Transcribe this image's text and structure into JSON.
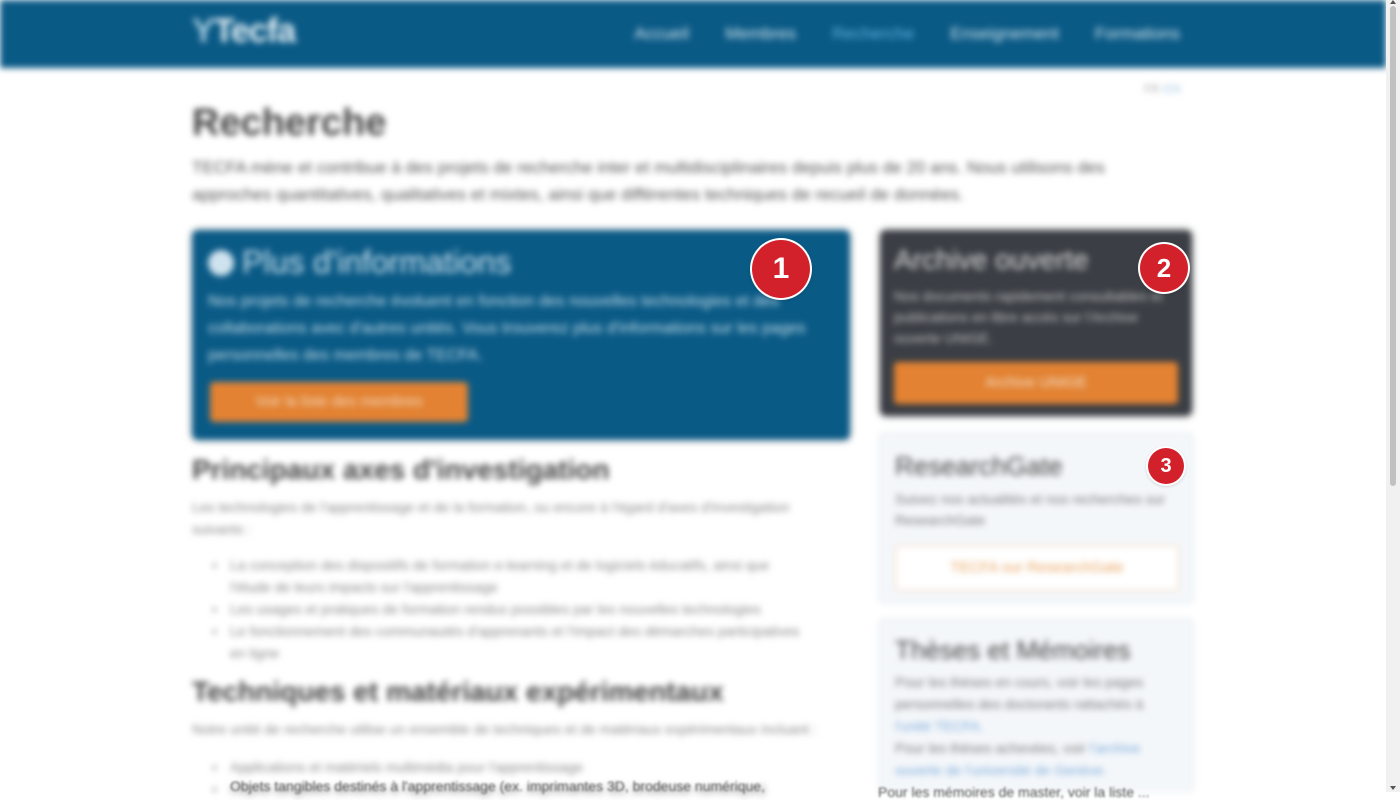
{
  "header": {
    "logo_prefix": "Y",
    "logo_text": "Tecfa",
    "nav": [
      "Accueil",
      "Membres",
      "Recherche",
      "Enseignement",
      "Formations"
    ],
    "active_index": 2
  },
  "lang": {
    "current": "FR",
    "alt": "EN"
  },
  "page": {
    "title": "Recherche",
    "intro": "TECFA mène et contribue à des projets de recherche inter et multidisciplinaires depuis plus de 20 ans. Nous utilisons des approches quantitatives, qualitatives et mixtes, ainsi que différentes techniques de recueil de données."
  },
  "info_box": {
    "title": "Plus d'informations",
    "text": "Nos projets de recherche évoluent en fonction des nouvelles technologies et des collaborations avec d'autres unités. Vous trouverez plus d'informations sur les pages personnelles des membres de TECFA.",
    "button": "Voir la liste des membres"
  },
  "open_archive": {
    "title": "Archive ouverte",
    "text": "Nos documents rapidement consultables et publications en libre accès sur l'Archive ouverte UNIGE.",
    "button": "Archive UNIGE"
  },
  "researchgate": {
    "title": "ResearchGate",
    "text": "Suivez nos actualités et nos recherches sur ResearchGate",
    "button": "TECFA sur ResearchGate"
  },
  "theses": {
    "title": "Thèses et Mémoires",
    "text1": "Pour les thèses en cours, voir les pages personnelles des doctorants rattachés à",
    "link1": "l'unité TECFA.",
    "text2": "Pour les thèses achevées, voir",
    "link2": "l'archive ouverte de l'université de Genève."
  },
  "section1": {
    "title": "Principaux axes d'investigation",
    "text": "Les technologies de l'apprentissage et de la formation, ou encore à l'égard d'axes d'investigation suivants :",
    "bullets": [
      "La conception des dispositifs de formation e-learning et de logiciels éducatifs, ainsi que l'étude de leurs impacts sur l'apprentissage",
      "Les usages et pratiques de formation rendus possibles par les nouvelles technologies",
      "Le fonctionnement des communautés d'apprenants et l'impact des démarches participatives en ligne"
    ]
  },
  "section2": {
    "title": "Techniques et matériaux expérimentaux",
    "text": "Notre unité de recherche utilise un ensemble de techniques et de matériaux expérimentaux incluant :",
    "bullets": [
      "Applications et matériels multimédia pour l'apprentissage",
      "Objets tangibles destinés à l'apprentissage (ex. imprimantes 3D, brodeuse numérique)"
    ]
  },
  "bottom": {
    "left_text": "Objets tangibles destinés à l'apprentissage (ex. imprimantes 3D, brodeuse numérique,",
    "right_text": "Pour les mémoires de master, voir la liste ..."
  },
  "markers": [
    "1",
    "2",
    "3"
  ]
}
